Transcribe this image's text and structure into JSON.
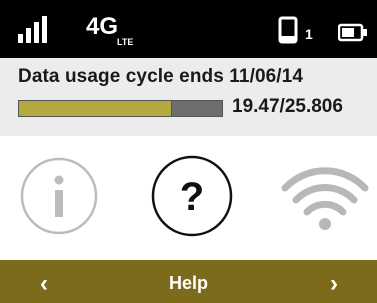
{
  "status_bar": {
    "network_label": "4G",
    "network_sub_label": "LTE",
    "device_count": "1"
  },
  "usage": {
    "cycle_text": "Data usage cycle ends 11/06/14",
    "usage_value": "19.47/25.806",
    "used_fraction": 0.7545
  },
  "carousel": {
    "items": [
      "info-icon",
      "help-icon",
      "wifi-icon"
    ],
    "selected": "help-icon"
  },
  "bottom_bar": {
    "title": "Help",
    "prev_glyph": "‹",
    "next_glyph": "›"
  },
  "colors": {
    "status_bar_bg": "#000000",
    "usage_bg": "#ececec",
    "bar_fill": "#b4a840",
    "bar_track": "#6e6e6e",
    "bottom_bar_bg": "#7d6b1c"
  }
}
